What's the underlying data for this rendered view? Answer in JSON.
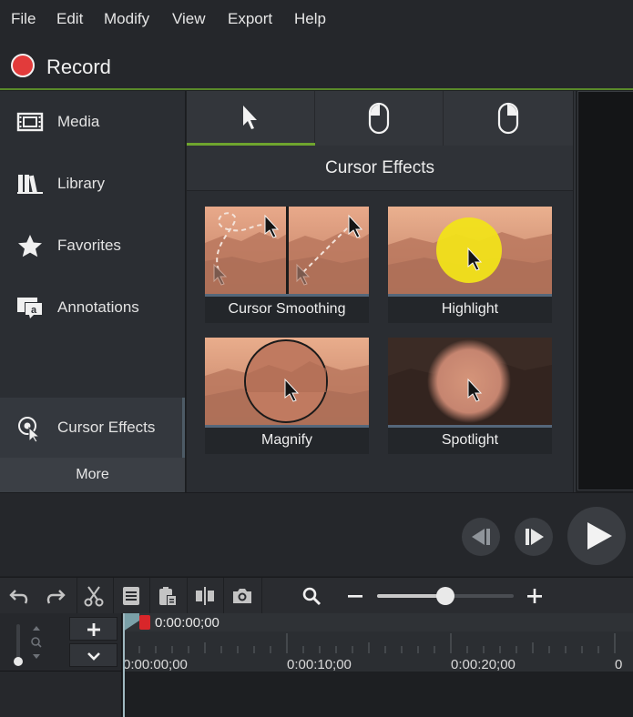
{
  "menu": [
    "File",
    "Edit",
    "Modify",
    "View",
    "Export",
    "Help"
  ],
  "record": {
    "label": "Record",
    "color": "#e23b3b"
  },
  "sidebar": {
    "items": [
      {
        "label": "Media",
        "icon": "film-icon"
      },
      {
        "label": "Library",
        "icon": "library-books-icon"
      },
      {
        "label": "Favorites",
        "icon": "star-icon"
      },
      {
        "label": "Annotations",
        "icon": "annotation-bubble-icon"
      },
      {
        "label": "Cursor Effects",
        "icon": "cursor-effects-icon",
        "active": true
      }
    ],
    "more_label": "More"
  },
  "panel": {
    "tabs": [
      "cursor-tab-icon",
      "left-click-tab-icon",
      "right-click-tab-icon"
    ],
    "title": "Cursor Effects",
    "cards": [
      {
        "label": "Cursor Smoothing"
      },
      {
        "label": "Highlight"
      },
      {
        "label": "Magnify"
      },
      {
        "label": "Spotlight"
      }
    ]
  },
  "toolbar": {
    "icons": [
      "undo-icon",
      "redo-icon",
      "cut-icon",
      "copy-icon",
      "paste-icon",
      "split-icon",
      "snapshot-icon",
      "zoom-search-icon",
      "zoom-out-icon",
      "zoom-in-icon"
    ],
    "zoom_level": 0.5
  },
  "timeline": {
    "playhead_time": "0:00:00;00",
    "ruler_labels": [
      "0:00:00;00",
      "0:00:10;00",
      "0:00:20;00"
    ],
    "accent": "#6fa52e"
  }
}
